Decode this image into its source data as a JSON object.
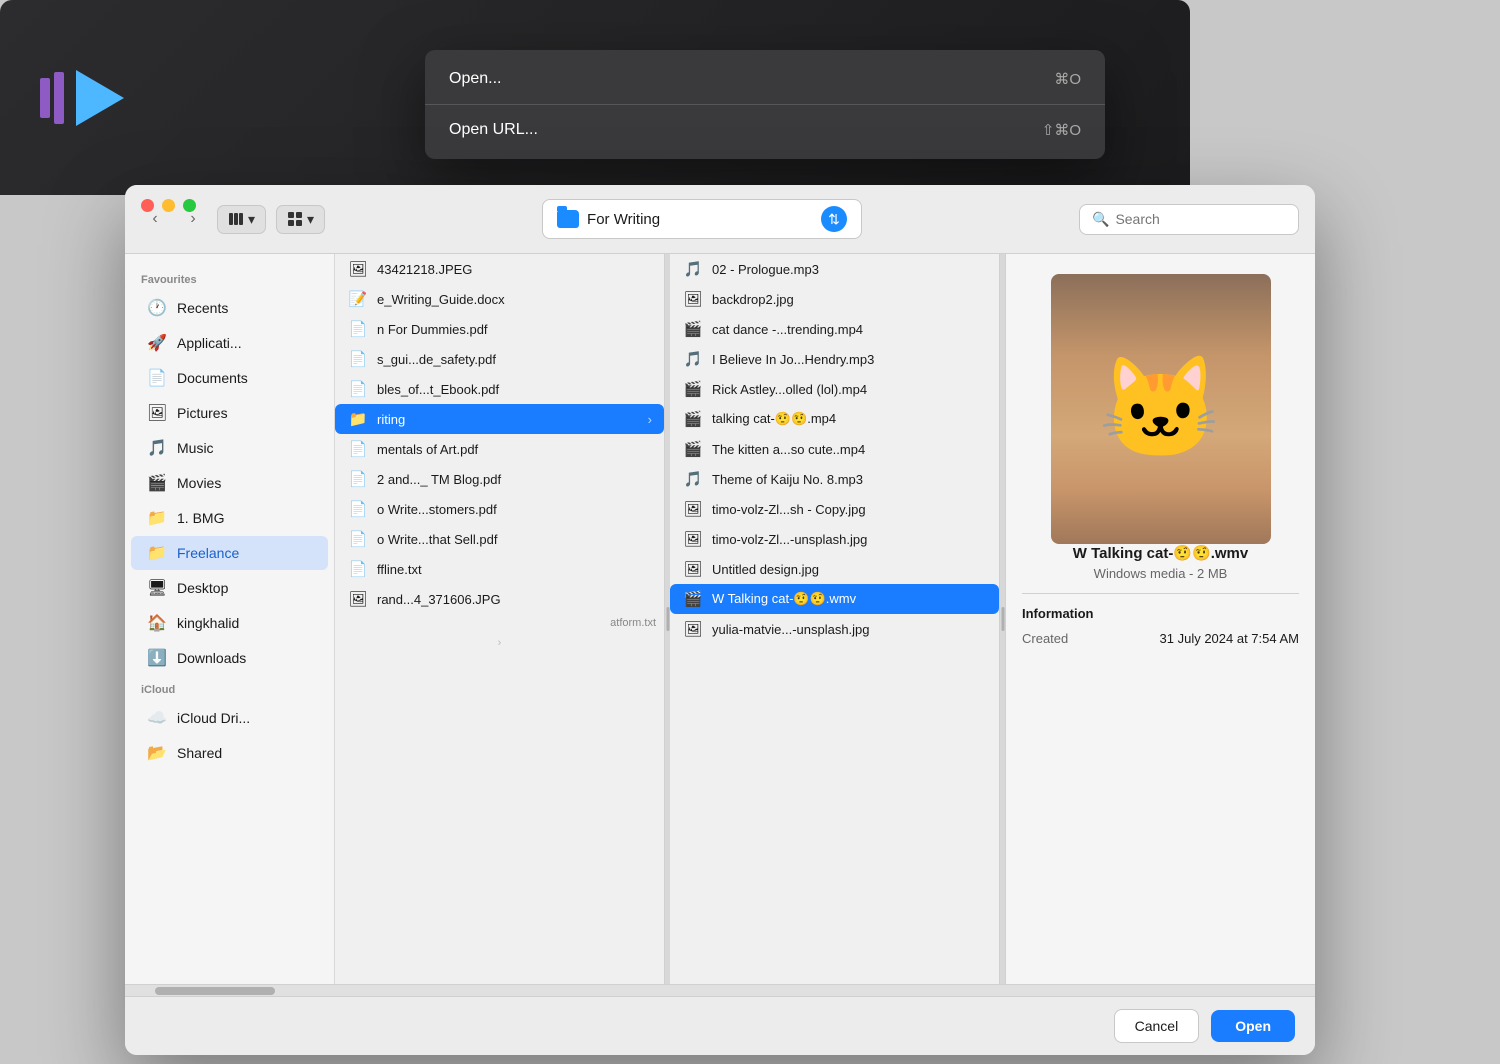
{
  "app": {
    "window_controls": [
      "close",
      "minimize",
      "maximize"
    ]
  },
  "context_menu": {
    "items": [
      {
        "label": "Open...",
        "shortcut": "⌘O"
      },
      {
        "label": "Open URL...",
        "shortcut": "⇧⌘O"
      }
    ]
  },
  "toolbar": {
    "location": "For Writing",
    "search_placeholder": "Search",
    "back_label": "‹",
    "forward_label": "›"
  },
  "sidebar": {
    "favourites_label": "Favourites",
    "icloud_label": "iCloud",
    "items_favourites": [
      {
        "id": "recents",
        "label": "Recents",
        "icon": "🕐"
      },
      {
        "id": "applications",
        "label": "Applicati...",
        "icon": "🚀"
      },
      {
        "id": "documents",
        "label": "Documents",
        "icon": "📄"
      },
      {
        "id": "pictures",
        "label": "Pictures",
        "icon": "🖼"
      },
      {
        "id": "music",
        "label": "Music",
        "icon": "🎵"
      },
      {
        "id": "movies",
        "label": "Movies",
        "icon": "🎬"
      },
      {
        "id": "bmg",
        "label": "1. BMG",
        "icon": "📁"
      },
      {
        "id": "freelance",
        "label": "Freelance",
        "icon": "📁",
        "active": true
      },
      {
        "id": "desktop",
        "label": "Desktop",
        "icon": "🖥"
      },
      {
        "id": "kingkhalid",
        "label": "kingkhalid",
        "icon": "🏠"
      },
      {
        "id": "downloads",
        "label": "Downloads",
        "icon": "⬇️"
      }
    ],
    "items_icloud": [
      {
        "id": "icloud-drive",
        "label": "iCloud Dri...",
        "icon": "☁️"
      },
      {
        "id": "shared",
        "label": "Shared",
        "icon": "📂"
      }
    ]
  },
  "column1": {
    "items": [
      {
        "name": "43421218.JPEG",
        "icon": "🖼",
        "selected": false
      },
      {
        "name": "e_Writing_Guide.docx",
        "icon": "📝",
        "selected": false
      },
      {
        "name": "n For Dummies.pdf",
        "icon": "📄",
        "selected": false
      },
      {
        "name": "s_gui...de_safety.pdf",
        "icon": "📄",
        "selected": false
      },
      {
        "name": "bles_of...t_Ebook.pdf",
        "icon": "📄",
        "selected": false
      },
      {
        "name": "riting",
        "icon": "📁",
        "selected": true,
        "has_arrow": true
      },
      {
        "name": "mentals of Art.pdf",
        "icon": "📄",
        "selected": false
      },
      {
        "name": "2 and..._ TM Blog.pdf",
        "icon": "📄",
        "selected": false
      },
      {
        "name": "o Write...stomers.pdf",
        "icon": "📄",
        "selected": false
      },
      {
        "name": "o Write...that Sell.pdf",
        "icon": "📄",
        "selected": false
      },
      {
        "name": "ffline.txt",
        "icon": "📄",
        "selected": false
      },
      {
        "name": "rand...4_371606.JPG",
        "icon": "🖼",
        "selected": false
      }
    ]
  },
  "column2": {
    "items": [
      {
        "name": "02 - Prologue.mp3",
        "icon": "🎵",
        "selected": false
      },
      {
        "name": "backdrop2.jpg",
        "icon": "🖼",
        "selected": false
      },
      {
        "name": "cat dance -...trending.mp4",
        "icon": "🎬",
        "selected": false
      },
      {
        "name": "I Believe In Jo...Hendry.mp3",
        "icon": "🎵",
        "selected": false
      },
      {
        "name": "Rick Astley...olled (lol).mp4",
        "icon": "🎬",
        "selected": false
      },
      {
        "name": "talking cat-🤨🤨.mp4",
        "icon": "🎬",
        "selected": false
      },
      {
        "name": "The kitten a...so cute..mp4",
        "icon": "🎬",
        "selected": false
      },
      {
        "name": "Theme of Kaiju No. 8.mp3",
        "icon": "🎵",
        "selected": false
      },
      {
        "name": "timo-volz-Zl...sh - Copy.jpg",
        "icon": "🖼",
        "selected": false
      },
      {
        "name": "timo-volz-Zl...-unsplash.jpg",
        "icon": "🖼",
        "selected": false
      },
      {
        "name": "Untitled design.jpg",
        "icon": "🖼",
        "selected": false
      },
      {
        "name": "W Talking cat-🤨🤨.wmv",
        "icon": "🎬",
        "selected": true
      },
      {
        "name": "yulia-matvie...-unsplash.jpg",
        "icon": "🖼",
        "selected": false
      }
    ]
  },
  "preview": {
    "title": "W Talking cat-🤨🤨.wmv",
    "subtitle": "Windows media - 2 MB",
    "info_section_title": "Information",
    "info_rows": [
      {
        "label": "Created",
        "value": "31 July 2024 at 7:54 AM"
      }
    ]
  },
  "footer": {
    "cancel_label": "Cancel",
    "open_label": "Open"
  },
  "column1_bottom_file": "atform.txt"
}
